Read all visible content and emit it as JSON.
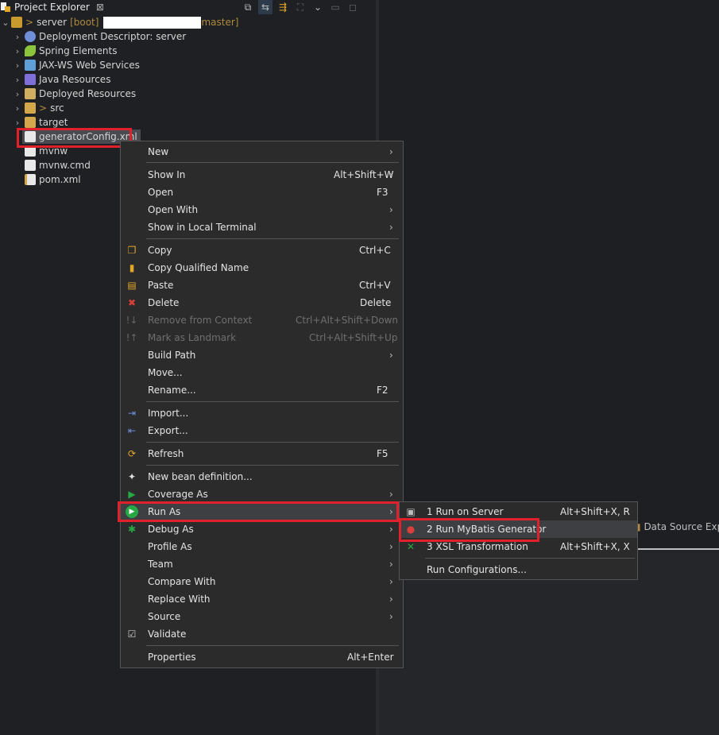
{
  "view": {
    "title": "Project Explorer",
    "close": "⊠"
  },
  "toolbar": [
    "⧉",
    "⇆",
    "⇶",
    "⛶",
    "⌄",
    "▭",
    "◻"
  ],
  "tree": {
    "project": {
      "name": "server",
      "prefix": ">",
      "boot": "[boot]",
      "branch": "master]"
    },
    "items": [
      {
        "label": "Deployment Descriptor: server"
      },
      {
        "label": "Spring Elements"
      },
      {
        "label": "JAX-WS Web Services"
      },
      {
        "label": "Java Resources"
      },
      {
        "label": "Deployed Resources"
      },
      {
        "label": "src",
        "prefix": ">"
      },
      {
        "label": "target"
      },
      {
        "label": "generatorConfig.xml"
      },
      {
        "label": "mvnw"
      },
      {
        "label": "mvnw.cmd"
      },
      {
        "label": "pom.xml"
      }
    ]
  },
  "context_menu": {
    "items": [
      {
        "label": "New",
        "shortcut": "",
        "sub": "›"
      },
      {
        "label": "Show In",
        "shortcut": "Alt+Shift+W",
        "sub": "›"
      },
      {
        "label": "Open",
        "shortcut": "F3"
      },
      {
        "label": "Open With",
        "sub": "›"
      },
      {
        "label": "Show in Local Terminal",
        "sub": "›"
      },
      {
        "label": "Copy",
        "shortcut": "Ctrl+C"
      },
      {
        "label": "Copy Qualified Name"
      },
      {
        "label": "Paste",
        "shortcut": "Ctrl+V"
      },
      {
        "label": "Delete",
        "shortcut": "Delete"
      },
      {
        "label": "Remove from Context",
        "shortcut": "Ctrl+Alt+Shift+Down"
      },
      {
        "label": "Mark as Landmark",
        "shortcut": "Ctrl+Alt+Shift+Up"
      },
      {
        "label": "Build Path",
        "sub": "›"
      },
      {
        "label": "Move..."
      },
      {
        "label": "Rename...",
        "shortcut": "F2"
      },
      {
        "label": "Import..."
      },
      {
        "label": "Export..."
      },
      {
        "label": "Refresh",
        "shortcut": "F5"
      },
      {
        "label": "New bean definition..."
      },
      {
        "label": "Coverage As",
        "sub": "›"
      },
      {
        "label": "Run As",
        "sub": "›"
      },
      {
        "label": "Debug As",
        "sub": "›"
      },
      {
        "label": "Profile As",
        "sub": "›"
      },
      {
        "label": "Team",
        "sub": "›"
      },
      {
        "label": "Compare With",
        "sub": "›"
      },
      {
        "label": "Replace With",
        "sub": "›"
      },
      {
        "label": "Source",
        "sub": "›"
      },
      {
        "label": "Validate"
      },
      {
        "label": "Properties",
        "shortcut": "Alt+Enter"
      }
    ]
  },
  "submenu": {
    "items": [
      {
        "label": "1 Run on Server",
        "shortcut": "Alt+Shift+X, R"
      },
      {
        "label": "2 Run MyBatis Generator",
        "shortcut": ""
      },
      {
        "label": "3 XSL Transformation",
        "shortcut": "Alt+Shift+X, X"
      },
      {
        "label": "Run Configurations..."
      }
    ]
  },
  "right_panel": {
    "tab_label": "Data Source Expl"
  },
  "colors": {
    "highlight_border": "#e0202a",
    "menu_bg": "#2b2b2b",
    "accent_green": "#27a844"
  }
}
